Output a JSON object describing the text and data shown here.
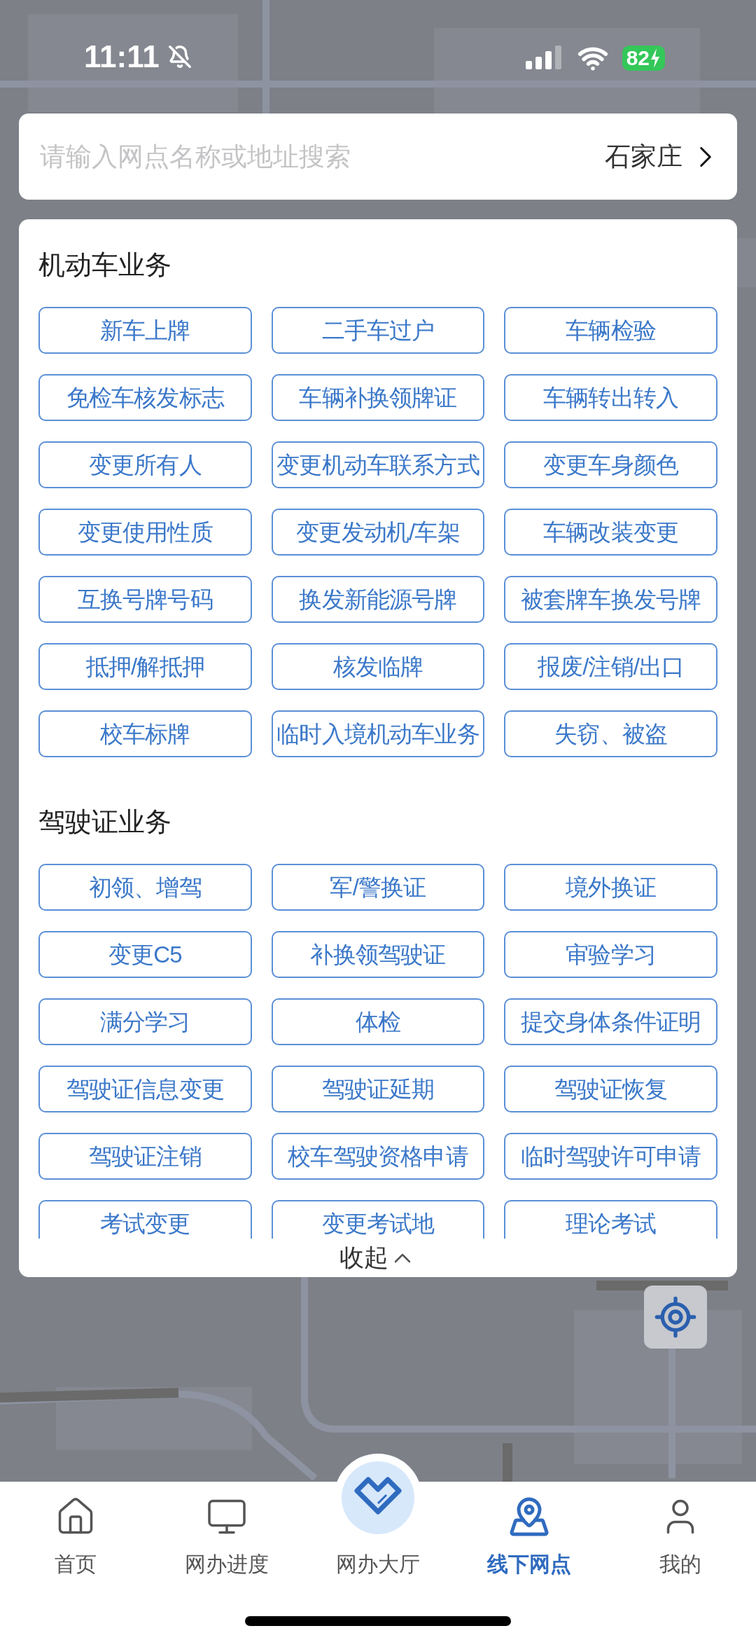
{
  "status_bar": {
    "time": "11:11",
    "battery": "82"
  },
  "search": {
    "placeholder": "请输入网点名称或地址搜索",
    "city": "石家庄"
  },
  "sections": [
    {
      "title": "机动车业务",
      "buttons": [
        "新车上牌",
        "二手车过户",
        "车辆检验",
        "免检车核发标志",
        "车辆补换领牌证",
        "车辆转出转入",
        "变更所有人",
        "变更机动车联系方式",
        "变更车身颜色",
        "变更使用性质",
        "变更发动机/车架",
        "车辆改装变更",
        "互换号牌号码",
        "换发新能源号牌",
        "被套牌车换发号牌",
        "抵押/解抵押",
        "核发临牌",
        "报废/注销/出口",
        "校车标牌",
        "临时入境机动车业务",
        "失窃、被盗"
      ]
    },
    {
      "title": "驾驶证业务",
      "buttons": [
        "初领、增驾",
        "军/警换证",
        "境外换证",
        "变更C5",
        "补换领驾驶证",
        "审验学习",
        "满分学习",
        "体检",
        "提交身体条件证明",
        "驾驶证信息变更",
        "驾驶证延期",
        "驾驶证恢复",
        "驾驶证注销",
        "校车驾驶资格申请",
        "临时驾驶许可申请",
        "考试变更",
        "变更考试地",
        "理论考试"
      ]
    }
  ],
  "collapse": {
    "label": "收起"
  },
  "nav": [
    {
      "kind": "home",
      "label": "首页",
      "selected": false
    },
    {
      "kind": "progress",
      "label": "网办进度",
      "selected": false
    },
    {
      "kind": "hall",
      "label": "网办大厅",
      "selected": false
    },
    {
      "kind": "offline",
      "label": "线下网点",
      "selected": true
    },
    {
      "kind": "me",
      "label": "我的",
      "selected": false
    }
  ]
}
